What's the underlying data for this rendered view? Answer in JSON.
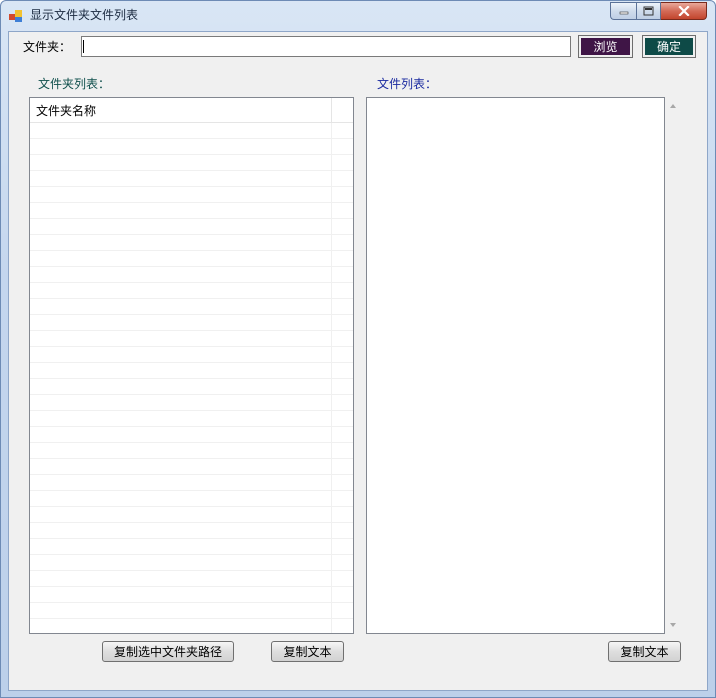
{
  "window": {
    "title": "显示文件夹文件列表"
  },
  "top": {
    "folder_label": "文件夹：",
    "path_value": "",
    "browse_label": "浏览",
    "confirm_label": "确定"
  },
  "left": {
    "section_label": "文件夹列表：",
    "column_header": "文件夹名称",
    "copy_path_label": "复制选中文件夹路径",
    "copy_text_label": "复制文本"
  },
  "right": {
    "section_label": "文件列表：",
    "copy_text_label": "复制文本"
  },
  "colors": {
    "browse_bg": "#3f1546",
    "confirm_bg": "#0e4a47",
    "left_label": "#0f4f4c",
    "right_label": "#1a2aa0"
  },
  "icons": {
    "app": "window-app-icon",
    "minimize": "minimize-icon",
    "maximize": "maximize-icon",
    "close": "close-icon"
  }
}
